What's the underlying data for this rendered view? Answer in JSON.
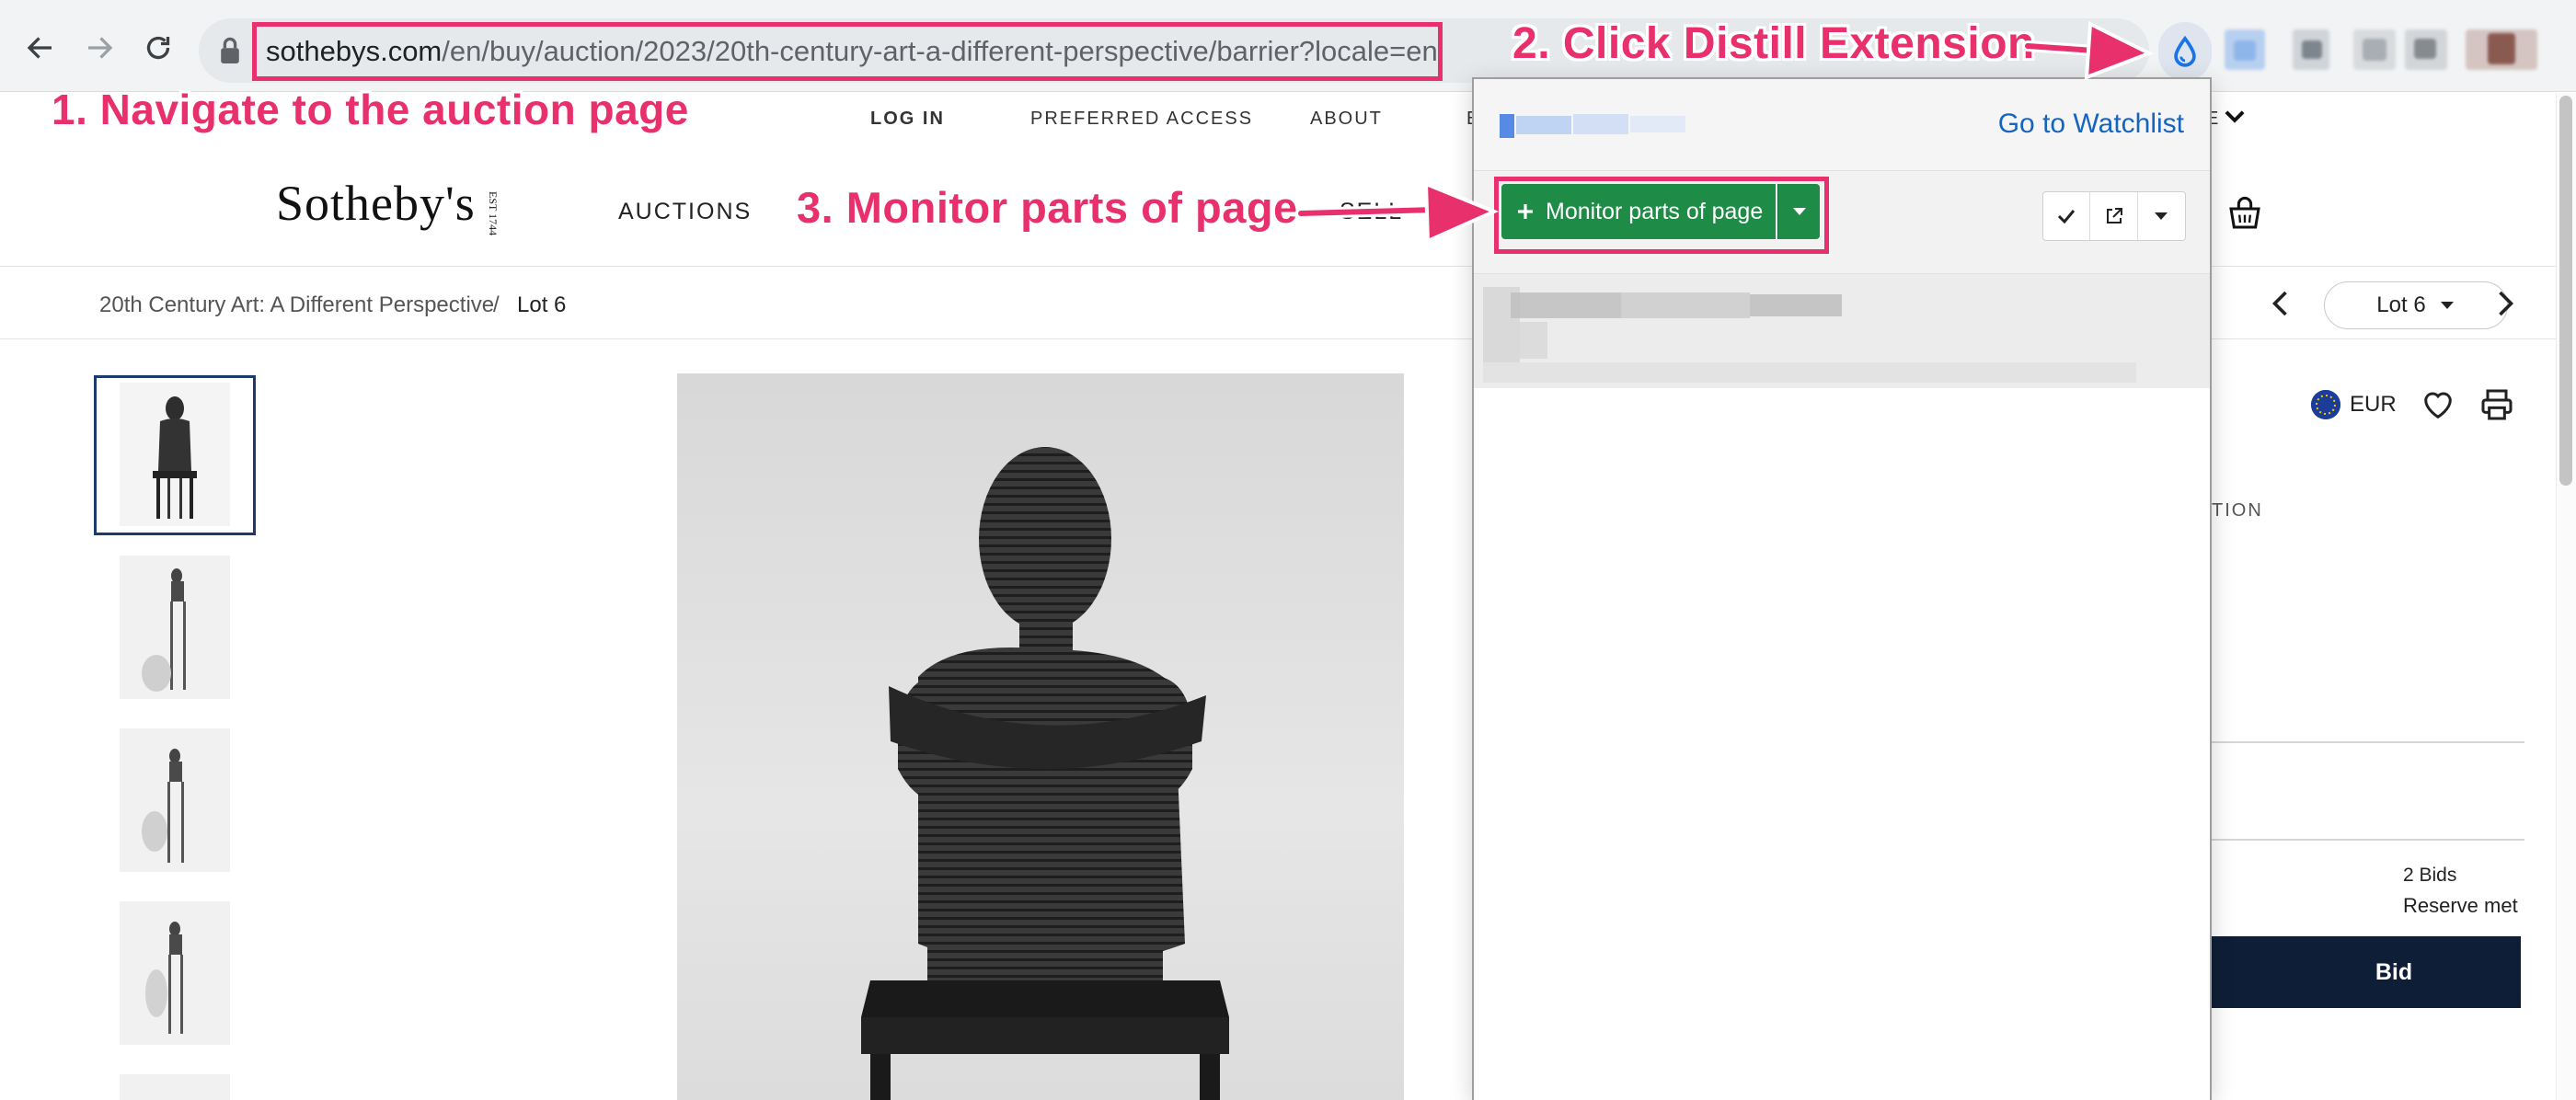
{
  "browser": {
    "url_host": "sothebys.com",
    "url_path": "/en/buy/auction/2023/20th-century-art-a-different-perspective/barrier?locale=en"
  },
  "site": {
    "util_links": [
      "LOG IN",
      "PREFERRED ACCESS",
      "ABOUT"
    ],
    "logo": "Sotheby's",
    "logo_est": "EST 1744",
    "nav": [
      "AUCTIONS",
      "SELL"
    ],
    "breadcrumb": {
      "auction": "20th Century Art: A Different Perspective",
      "separator": "/",
      "lot": "Lot 6"
    },
    "lot_selector": "Lot 6",
    "currency": "EUR",
    "partial_label": "TION",
    "bids": "2 Bids",
    "reserve": "Reserve met",
    "bid_button": "Bid"
  },
  "distill_popup": {
    "watchlist_link": "Go to Watchlist",
    "monitor_button": "Monitor parts of page"
  },
  "annotations": {
    "step1": "1. Navigate to the auction page",
    "step2": "2. Click Distill Extension",
    "step3": "3. Monitor parts of page",
    "color": "#e8306c"
  },
  "colors": {
    "distill_green": "#1e8b46",
    "bid_button_navy": "#0d1e36",
    "link_blue": "#1565c0"
  }
}
